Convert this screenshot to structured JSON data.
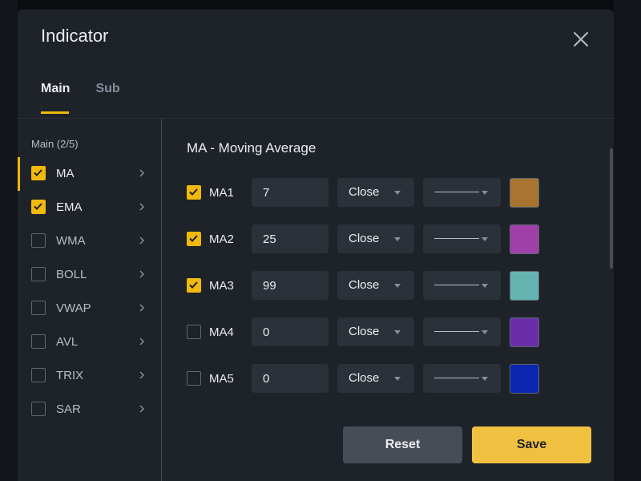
{
  "modal": {
    "title": "Indicator",
    "tabs": [
      {
        "label": "Main",
        "active": true
      },
      {
        "label": "Sub",
        "active": false
      }
    ]
  },
  "sidebar": {
    "heading": "Main (2/5)",
    "items": [
      {
        "label": "MA",
        "checked": true,
        "active": true
      },
      {
        "label": "EMA",
        "checked": true,
        "active": false
      },
      {
        "label": "WMA",
        "checked": false,
        "active": false
      },
      {
        "label": "BOLL",
        "checked": false,
        "active": false
      },
      {
        "label": "VWAP",
        "checked": false,
        "active": false
      },
      {
        "label": "AVL",
        "checked": false,
        "active": false
      },
      {
        "label": "TRIX",
        "checked": false,
        "active": false
      },
      {
        "label": "SAR",
        "checked": false,
        "active": false
      }
    ]
  },
  "panel": {
    "title": "MA - Moving Average",
    "rows": [
      {
        "label": "MA1",
        "checked": true,
        "value": "7",
        "source": "Close",
        "color": "#a9742f"
      },
      {
        "label": "MA2",
        "checked": true,
        "value": "25",
        "source": "Close",
        "color": "#a03fa8"
      },
      {
        "label": "MA3",
        "checked": true,
        "value": "99",
        "source": "Close",
        "color": "#66b4b2"
      },
      {
        "label": "MA4",
        "checked": false,
        "value": "0",
        "source": "Close",
        "color": "#6a2fa8"
      },
      {
        "label": "MA5",
        "checked": false,
        "value": "0",
        "source": "Close",
        "color": "#0a26b0"
      }
    ]
  },
  "actions": {
    "reset_label": "Reset",
    "save_label": "Save"
  },
  "colors": {
    "accent": "#f0b90b",
    "modal_bg": "#1e2329",
    "field_bg": "#2b3139"
  }
}
